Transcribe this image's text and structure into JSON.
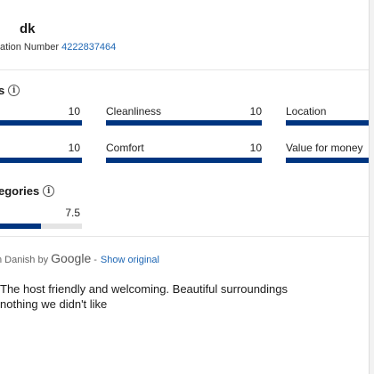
{
  "host": {
    "name": "dk",
    "registration_label": "ation Number",
    "registration_number": "4222837464"
  },
  "scores": {
    "title": "s",
    "categories": [
      {
        "label": "",
        "value": "10",
        "fraction": 1.0
      },
      {
        "label": "Cleanliness",
        "value": "10",
        "fraction": 1.0
      },
      {
        "label": "Location",
        "value": "",
        "fraction": 1.0
      },
      {
        "label": "",
        "value": "10",
        "fraction": 1.0
      },
      {
        "label": "Comfort",
        "value": "10",
        "fraction": 1.0
      },
      {
        "label": "Value for money",
        "value": "",
        "fraction": 1.0
      }
    ]
  },
  "subcategories": {
    "title": "egories",
    "items": [
      {
        "label": "",
        "value": "7.5",
        "fraction": 0.5
      }
    ]
  },
  "translation": {
    "prefix": "n Danish by",
    "brand": "Google",
    "separator": "-",
    "show_original": "Show original"
  },
  "review": {
    "positive": "The host friendly and welcoming. Beautiful surroundings",
    "negative": "nothing we didn't like"
  }
}
